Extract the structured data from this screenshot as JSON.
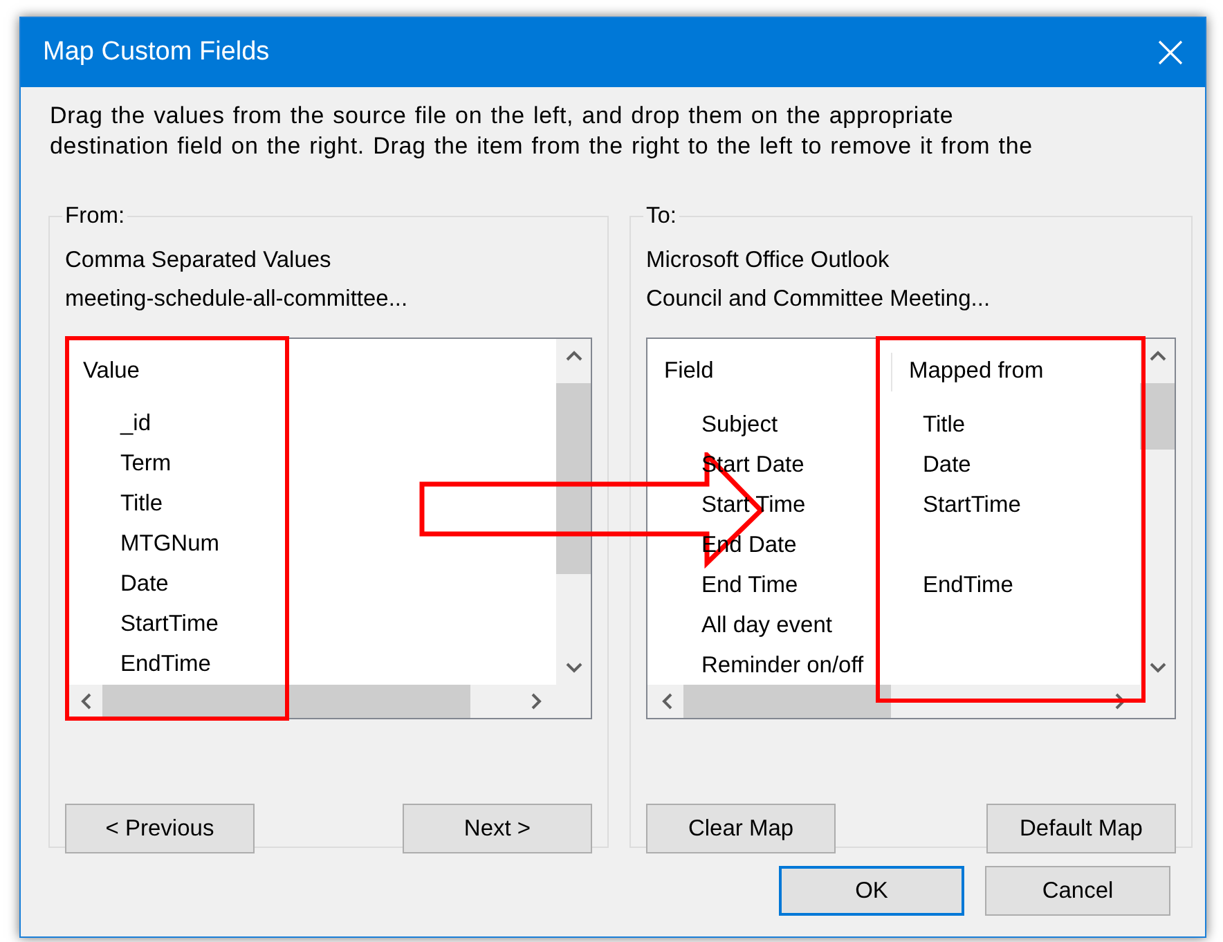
{
  "window": {
    "title": "Map Custom Fields"
  },
  "instructions": [
    "Drag the values from the source file on the left, and drop them on the appropriate",
    "destination field on the right.  Drag the item from the right to the left to remove it from the"
  ],
  "from": {
    "label": "From:",
    "source_type": "Comma Separated Values",
    "source_file": "meeting-schedule-all-committee...",
    "header": "Value",
    "items": [
      "_id",
      "Term",
      "Title",
      "MTGNum",
      "Date",
      "StartTime",
      "EndTime"
    ],
    "buttons": [
      "< Previous",
      "Next >"
    ]
  },
  "to": {
    "label": "To:",
    "target_app": "Microsoft Office Outlook",
    "target_folder": "Council and Committee Meeting...",
    "columns": [
      "Field",
      "Mapped from"
    ],
    "rows": [
      {
        "field": "Subject",
        "mapped_from": "Title"
      },
      {
        "field": "Start Date",
        "mapped_from": "Date"
      },
      {
        "field": "Start Time",
        "mapped_from": "StartTime"
      },
      {
        "field": "End Date"
      },
      {
        "field": "End Time",
        "mapped_from": "EndTime"
      },
      {
        "field": "All day event"
      },
      {
        "field": "Reminder on/off"
      }
    ],
    "buttons": [
      "Clear Map",
      "Default Map"
    ]
  },
  "dialog_buttons": [
    {
      "label": "OK",
      "default": true
    },
    {
      "label": "Cancel",
      "default": false
    }
  ]
}
